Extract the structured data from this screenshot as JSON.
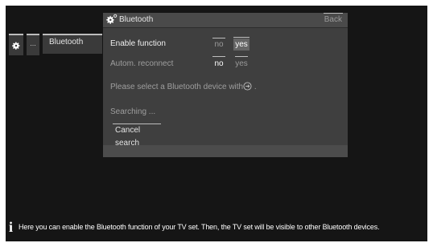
{
  "nav": {
    "gear_icon": "gear-icon",
    "dots_label": "...",
    "bluetooth_label": "Bluetooth"
  },
  "dialog": {
    "title": "Bluetooth",
    "title_icon": "gear-icon",
    "back_label": "Back",
    "rows": [
      {
        "label": "Enable function",
        "no": "no",
        "yes": "yes",
        "selected": "yes"
      },
      {
        "label": "Autom. reconnect",
        "no": "no",
        "yes": "yes",
        "selected": "no"
      }
    ],
    "message_before": "Please select a Bluetooth device with",
    "message_icon": "remote-button-icon",
    "message_after": " .",
    "searching": "Searching ...",
    "cancel_label": "Cancel search"
  },
  "info": {
    "icon": "info-icon",
    "icon_glyph": "i",
    "text": "Here you can enable the Bluetooth function of your TV set. Then, the TV set will be visible to other Bluetooth devices."
  },
  "colors": {
    "background": "#151515",
    "dialog": "#3f3f3f",
    "highlight": "#666666"
  }
}
